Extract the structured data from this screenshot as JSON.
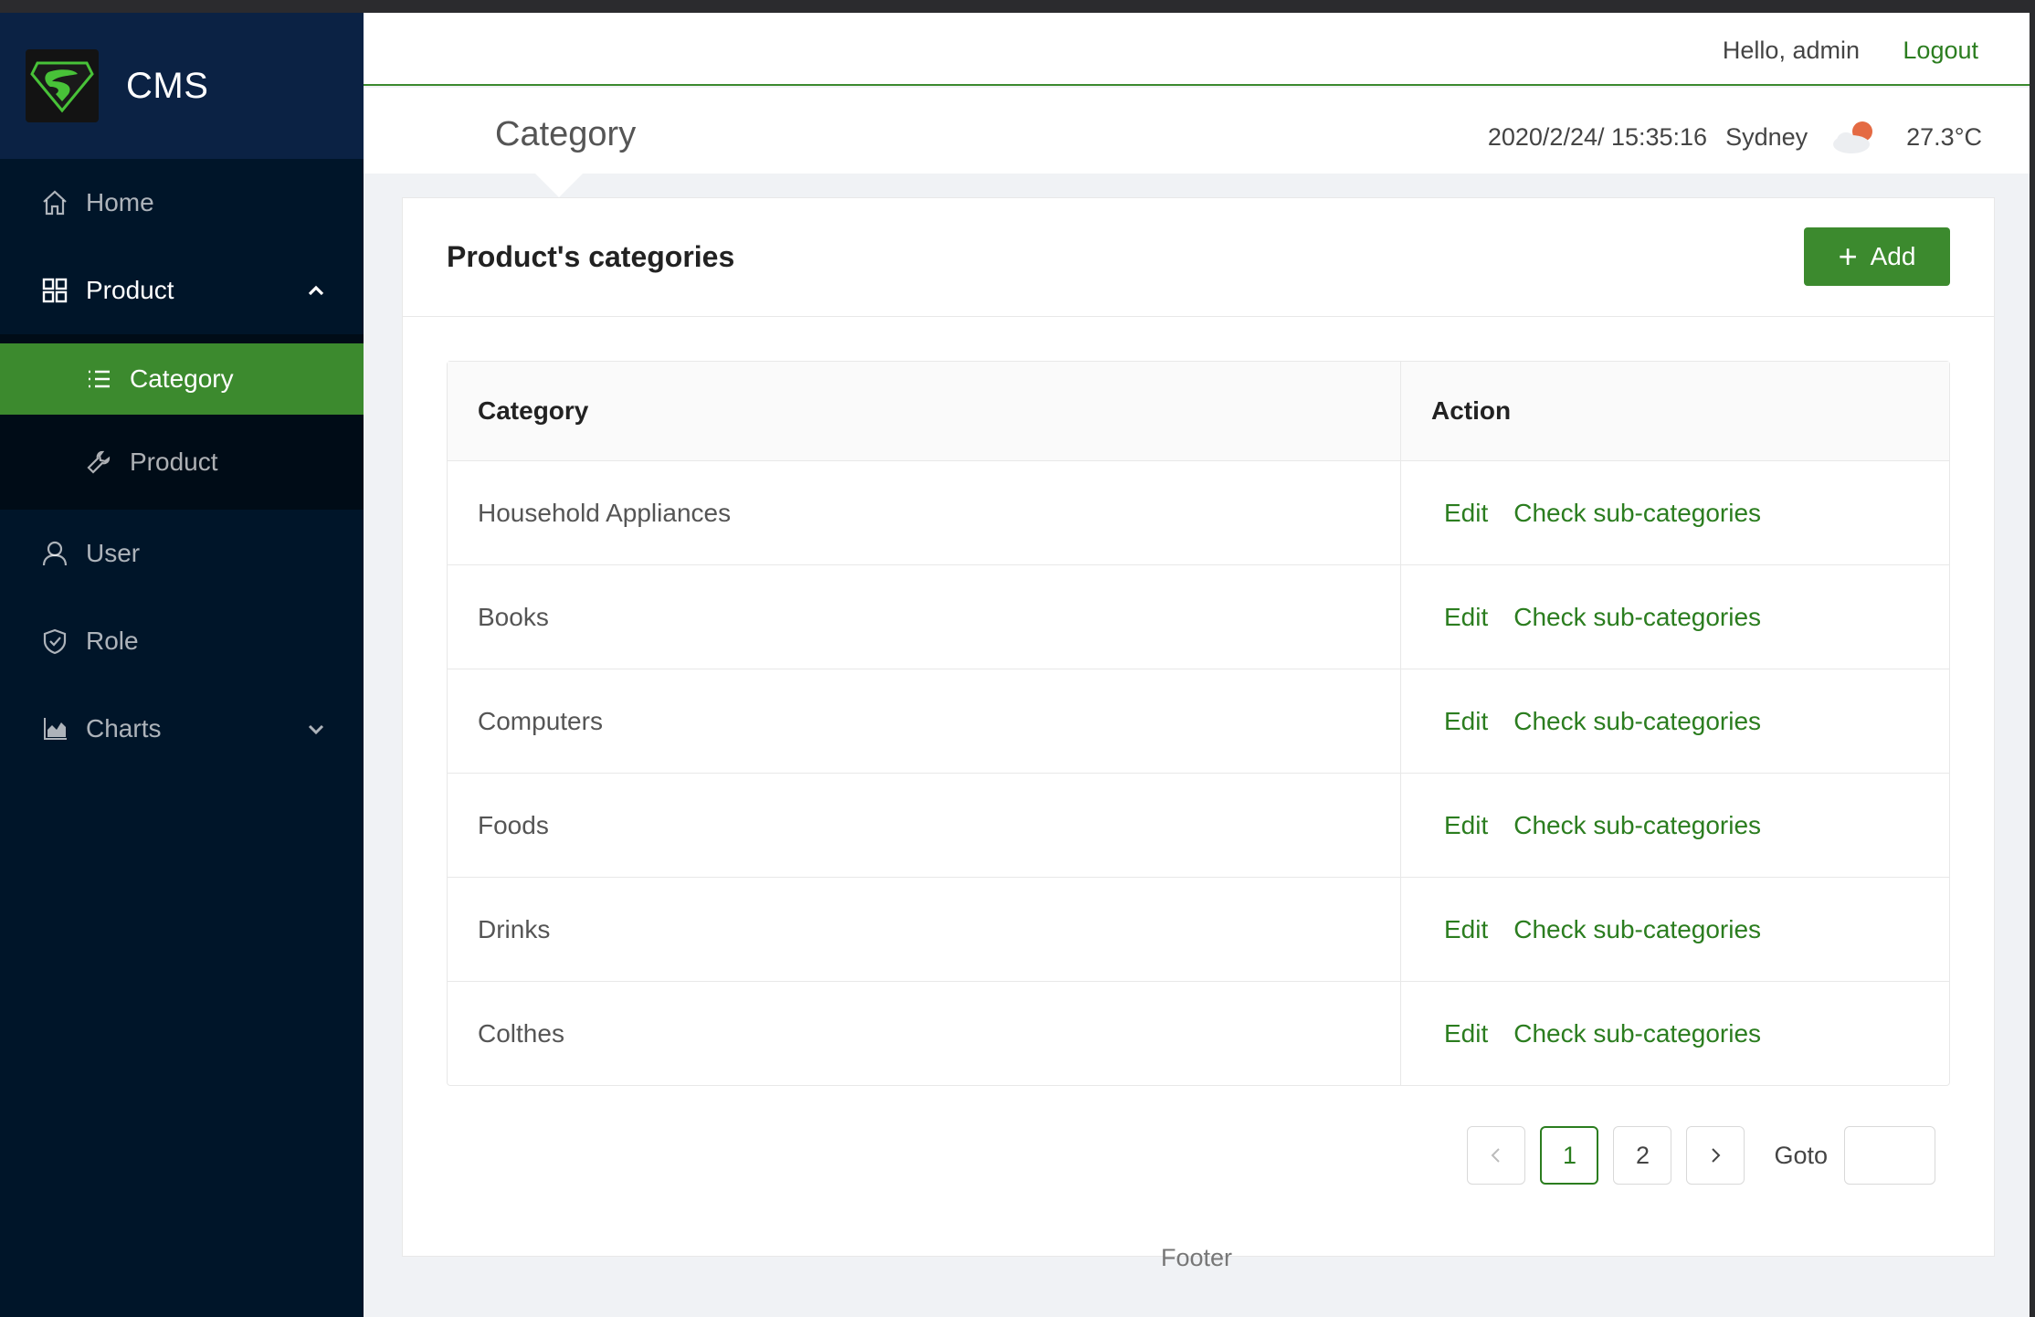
{
  "brand": {
    "name": "CMS"
  },
  "sidebar": {
    "items": [
      {
        "label": "Home",
        "icon": "home-icon"
      },
      {
        "label": "Product",
        "icon": "appstore-icon",
        "expanded": true,
        "children": [
          {
            "label": "Category",
            "icon": "list-icon",
            "active": true
          },
          {
            "label": "Product",
            "icon": "tool-icon"
          }
        ]
      },
      {
        "label": "User",
        "icon": "user-icon"
      },
      {
        "label": "Role",
        "icon": "safety-icon"
      },
      {
        "label": "Charts",
        "icon": "area-chart-icon",
        "expanded": false
      }
    ]
  },
  "header": {
    "greeting": "Hello, admin",
    "logout": "Logout"
  },
  "subheader": {
    "title": "Category",
    "datetime": "2020/2/24/ 15:35:16",
    "city": "Sydney",
    "temperature": "27.3°C",
    "weather_icon": "partly-cloudy-icon"
  },
  "card": {
    "title": "Product's categories",
    "add_label": "Add"
  },
  "table": {
    "columns": [
      "Category",
      "Action"
    ],
    "rows": [
      {
        "name": "Household Appliances",
        "edit": "Edit",
        "check": "Check sub-categories"
      },
      {
        "name": "Books",
        "edit": "Edit",
        "check": "Check sub-categories"
      },
      {
        "name": "Computers",
        "edit": "Edit",
        "check": "Check sub-categories"
      },
      {
        "name": "Foods",
        "edit": "Edit",
        "check": "Check sub-categories"
      },
      {
        "name": "Drinks",
        "edit": "Edit",
        "check": "Check sub-categories"
      },
      {
        "name": "Colthes",
        "edit": "Edit",
        "check": "Check sub-categories"
      }
    ]
  },
  "pagination": {
    "prev": "<",
    "pages": [
      "1",
      "2"
    ],
    "current": "1",
    "next": ">",
    "goto_label": "Goto"
  },
  "footer": {
    "text": "Footer"
  },
  "colors": {
    "accent": "#3c8a2e",
    "sidebar": "#001529",
    "link": "#2b7d1f"
  }
}
